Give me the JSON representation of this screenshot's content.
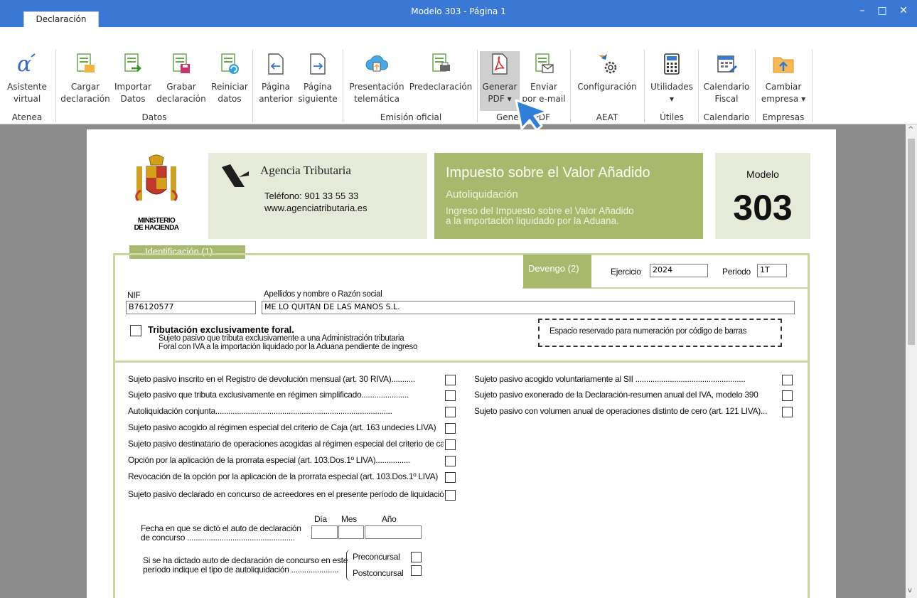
{
  "window": {
    "title": "Modelo 303 - Página 1",
    "minimize": "–",
    "maximize": "□",
    "close": "✕"
  },
  "ribbon": {
    "tab": "Declaración",
    "buttons": {
      "asistente": [
        "Asistente",
        "virtual"
      ],
      "cargar": [
        "Cargar",
        "declaración"
      ],
      "importar": [
        "Importar",
        "Datos"
      ],
      "grabar": [
        "Grabar",
        "declaración"
      ],
      "reiniciar": [
        "Reiniciar",
        "datos"
      ],
      "anterior": [
        "Página",
        "anterior"
      ],
      "siguiente": [
        "Página",
        "siguiente"
      ],
      "presentacion": [
        "Presentación",
        "telemática"
      ],
      "predeclaracion": [
        "Predeclaración",
        ""
      ],
      "generar": [
        "Generar",
        "PDF ▾"
      ],
      "enviar": [
        "Enviar",
        "por e-mail"
      ],
      "configuracion": [
        "Configuración",
        ""
      ],
      "utilidades": [
        "Utilidades",
        "▾"
      ],
      "calendario": [
        "Calendario",
        "Fiscal"
      ],
      "cambiar": [
        "Cambiar",
        "empresa ▾"
      ]
    },
    "groups": {
      "atenea": "Atenea",
      "datos": "Datos",
      "emision": "Emisión oficial",
      "pdf": "Generar PDF",
      "aeat": "AEAT",
      "utiles": "Útiles",
      "calendario": "Calendario",
      "empresas": "Empresas"
    }
  },
  "form": {
    "ministerio": [
      "MINISTERIO",
      "DE HACIENDA"
    ],
    "agencia": "Agencia Tributaria",
    "telefono": "Teléfono: 901 33 55 33",
    "web": "www.agenciatributaria.es",
    "impuesto_title": "Impuesto sobre el Valor Añadido",
    "autoliquidacion": "Autoliquidación",
    "ingreso_1": "Ingreso del Impuesto sobre el Valor Añadido",
    "ingreso_2": "a la importación liquidado por la Aduana.",
    "modelo_label": "Modelo",
    "modelo_num": "303",
    "identificacion": "Identificación (1)",
    "devengo": "Devengo (2)",
    "ejercicio_label": "Ejercicio",
    "ejercicio_value": "2024",
    "periodo_label": "Período",
    "periodo_value": "1T",
    "nif_label": "NIF",
    "nif_value": "B76120577",
    "razon_label": "Apellidos y nombre o Razón social",
    "razon_value": "ME LO QUITAN DE LAS MANOS S.L.",
    "foral_title": "Tributación exclusivamente foral.",
    "foral_1": "Sujeto pasivo que tributa exclusivamente a una Administración tributaria",
    "foral_2": "Foral con IVA a la importación liquidado por la Aduana pendiente de ingreso",
    "barcode": "Espacio reservado para numeración por código de barras",
    "left_items": [
      "Sujeto pasivo inscrito en el Registro de devolución mensual (art. 30 RIVA)...........",
      "Sujeto pasivo que tributa exclusivamente en régimen simplificado......................",
      "Autoliquidación conjunta..................................................................................",
      "Sujeto pasivo acogido al régimen especial del criterio de Caja (art. 163 undecies LIVA)",
      "Sujeto pasivo destinatario de operaciones acogidas al régimen especial del criterio de caja",
      "Opción por la aplicación de la prorrata especial (art. 103.Dos.1º LIVA)................",
      "Revocación de la opción por la aplicación de la prorrata especial (art. 103.Dos.1º LIVA)",
      "Sujeto pasivo declarado en concurso de acreedores en el presente período de liquidación"
    ],
    "right_items": [
      "Sujeto pasivo acogido voluntariamente al SII ...................................................",
      "Sujeto pasivo exonerado de la Declaración-resumen anual del IVA, modelo 390",
      "Sujeto pasivo con volumen anual de operaciones distinto de cero (art. 121 LIVA)..."
    ],
    "dia": "Día",
    "mes": "Mes",
    "anio": "Año",
    "fecha_1": "Fecha en que se dictó el auto de declaración",
    "fecha_2": "de concurso ..................................................",
    "concurso_1": "Si se ha dictado auto de declaración de concurso en este",
    "concurso_2": "período indique el tipo de autoliquidación ......................",
    "preconcursal": "Preconcursal",
    "postconcursal": "Postconcursal"
  }
}
